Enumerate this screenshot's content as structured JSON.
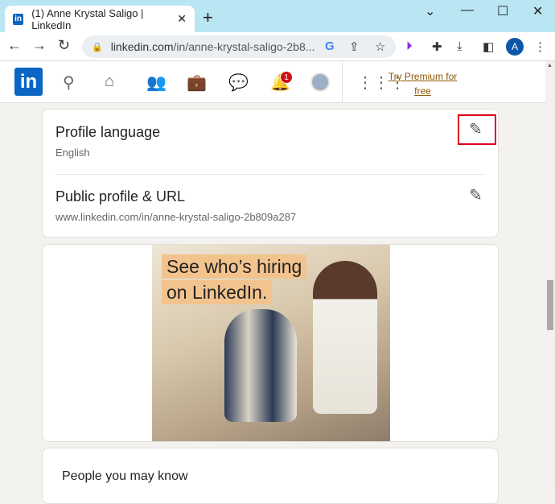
{
  "browser": {
    "tab_title": "(1) Anne Krystal Saligo | LinkedIn",
    "url_host": "linkedin.com",
    "url_path": "/in/anne-krystal-saligo-2b8...",
    "profile_initial": "A"
  },
  "linkedin_nav": {
    "logo": "in",
    "notification_count": "1",
    "premium_line1": "Try Premium for",
    "premium_line2": "free"
  },
  "settings": {
    "profile_language_label": "Profile language",
    "profile_language_value": "English",
    "public_profile_label": "Public profile & URL",
    "public_profile_url": "www.linkedin.com/in/anne-krystal-saligo-2b809a287"
  },
  "ad": {
    "line1": "See who’s hiring",
    "line2": "on LinkedIn."
  },
  "people": {
    "title": "People you may know"
  },
  "colors": {
    "linkedin_blue": "#0a66c2",
    "highlight": "#e0001b",
    "premium": "#915907"
  }
}
